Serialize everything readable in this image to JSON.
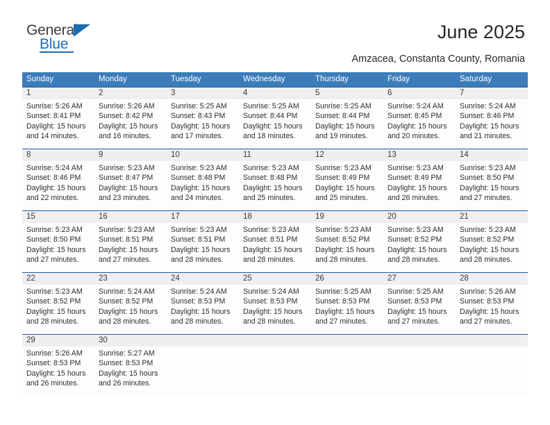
{
  "brand": {
    "name_part1": "General",
    "name_part2": "Blue",
    "triangle_icon": "triangle-icon",
    "accent_color": "#1f6cb0"
  },
  "header": {
    "title": "June 2025",
    "subtitle": "Amzacea, Constanta County, Romania"
  },
  "calendar": {
    "header_bg": "#3c7cba",
    "day_number_bg": "#efefef",
    "week_border_color": "#1f5d9b",
    "day_names": [
      "Sunday",
      "Monday",
      "Tuesday",
      "Wednesday",
      "Thursday",
      "Friday",
      "Saturday"
    ],
    "weeks": [
      [
        {
          "day": "1",
          "sunrise": "Sunrise: 5:26 AM",
          "sunset": "Sunset: 8:41 PM",
          "daylight_line1": "Daylight: 15 hours",
          "daylight_line2": "and 14 minutes."
        },
        {
          "day": "2",
          "sunrise": "Sunrise: 5:26 AM",
          "sunset": "Sunset: 8:42 PM",
          "daylight_line1": "Daylight: 15 hours",
          "daylight_line2": "and 16 minutes."
        },
        {
          "day": "3",
          "sunrise": "Sunrise: 5:25 AM",
          "sunset": "Sunset: 8:43 PM",
          "daylight_line1": "Daylight: 15 hours",
          "daylight_line2": "and 17 minutes."
        },
        {
          "day": "4",
          "sunrise": "Sunrise: 5:25 AM",
          "sunset": "Sunset: 8:44 PM",
          "daylight_line1": "Daylight: 15 hours",
          "daylight_line2": "and 18 minutes."
        },
        {
          "day": "5",
          "sunrise": "Sunrise: 5:25 AM",
          "sunset": "Sunset: 8:44 PM",
          "daylight_line1": "Daylight: 15 hours",
          "daylight_line2": "and 19 minutes."
        },
        {
          "day": "6",
          "sunrise": "Sunrise: 5:24 AM",
          "sunset": "Sunset: 8:45 PM",
          "daylight_line1": "Daylight: 15 hours",
          "daylight_line2": "and 20 minutes."
        },
        {
          "day": "7",
          "sunrise": "Sunrise: 5:24 AM",
          "sunset": "Sunset: 8:46 PM",
          "daylight_line1": "Daylight: 15 hours",
          "daylight_line2": "and 21 minutes."
        }
      ],
      [
        {
          "day": "8",
          "sunrise": "Sunrise: 5:24 AM",
          "sunset": "Sunset: 8:46 PM",
          "daylight_line1": "Daylight: 15 hours",
          "daylight_line2": "and 22 minutes."
        },
        {
          "day": "9",
          "sunrise": "Sunrise: 5:23 AM",
          "sunset": "Sunset: 8:47 PM",
          "daylight_line1": "Daylight: 15 hours",
          "daylight_line2": "and 23 minutes."
        },
        {
          "day": "10",
          "sunrise": "Sunrise: 5:23 AM",
          "sunset": "Sunset: 8:48 PM",
          "daylight_line1": "Daylight: 15 hours",
          "daylight_line2": "and 24 minutes."
        },
        {
          "day": "11",
          "sunrise": "Sunrise: 5:23 AM",
          "sunset": "Sunset: 8:48 PM",
          "daylight_line1": "Daylight: 15 hours",
          "daylight_line2": "and 25 minutes."
        },
        {
          "day": "12",
          "sunrise": "Sunrise: 5:23 AM",
          "sunset": "Sunset: 8:49 PM",
          "daylight_line1": "Daylight: 15 hours",
          "daylight_line2": "and 25 minutes."
        },
        {
          "day": "13",
          "sunrise": "Sunrise: 5:23 AM",
          "sunset": "Sunset: 8:49 PM",
          "daylight_line1": "Daylight: 15 hours",
          "daylight_line2": "and 26 minutes."
        },
        {
          "day": "14",
          "sunrise": "Sunrise: 5:23 AM",
          "sunset": "Sunset: 8:50 PM",
          "daylight_line1": "Daylight: 15 hours",
          "daylight_line2": "and 27 minutes."
        }
      ],
      [
        {
          "day": "15",
          "sunrise": "Sunrise: 5:23 AM",
          "sunset": "Sunset: 8:50 PM",
          "daylight_line1": "Daylight: 15 hours",
          "daylight_line2": "and 27 minutes."
        },
        {
          "day": "16",
          "sunrise": "Sunrise: 5:23 AM",
          "sunset": "Sunset: 8:51 PM",
          "daylight_line1": "Daylight: 15 hours",
          "daylight_line2": "and 27 minutes."
        },
        {
          "day": "17",
          "sunrise": "Sunrise: 5:23 AM",
          "sunset": "Sunset: 8:51 PM",
          "daylight_line1": "Daylight: 15 hours",
          "daylight_line2": "and 28 minutes."
        },
        {
          "day": "18",
          "sunrise": "Sunrise: 5:23 AM",
          "sunset": "Sunset: 8:51 PM",
          "daylight_line1": "Daylight: 15 hours",
          "daylight_line2": "and 28 minutes."
        },
        {
          "day": "19",
          "sunrise": "Sunrise: 5:23 AM",
          "sunset": "Sunset: 8:52 PM",
          "daylight_line1": "Daylight: 15 hours",
          "daylight_line2": "and 28 minutes."
        },
        {
          "day": "20",
          "sunrise": "Sunrise: 5:23 AM",
          "sunset": "Sunset: 8:52 PM",
          "daylight_line1": "Daylight: 15 hours",
          "daylight_line2": "and 28 minutes."
        },
        {
          "day": "21",
          "sunrise": "Sunrise: 5:23 AM",
          "sunset": "Sunset: 8:52 PM",
          "daylight_line1": "Daylight: 15 hours",
          "daylight_line2": "and 28 minutes."
        }
      ],
      [
        {
          "day": "22",
          "sunrise": "Sunrise: 5:23 AM",
          "sunset": "Sunset: 8:52 PM",
          "daylight_line1": "Daylight: 15 hours",
          "daylight_line2": "and 28 minutes."
        },
        {
          "day": "23",
          "sunrise": "Sunrise: 5:24 AM",
          "sunset": "Sunset: 8:52 PM",
          "daylight_line1": "Daylight: 15 hours",
          "daylight_line2": "and 28 minutes."
        },
        {
          "day": "24",
          "sunrise": "Sunrise: 5:24 AM",
          "sunset": "Sunset: 8:53 PM",
          "daylight_line1": "Daylight: 15 hours",
          "daylight_line2": "and 28 minutes."
        },
        {
          "day": "25",
          "sunrise": "Sunrise: 5:24 AM",
          "sunset": "Sunset: 8:53 PM",
          "daylight_line1": "Daylight: 15 hours",
          "daylight_line2": "and 28 minutes."
        },
        {
          "day": "26",
          "sunrise": "Sunrise: 5:25 AM",
          "sunset": "Sunset: 8:53 PM",
          "daylight_line1": "Daylight: 15 hours",
          "daylight_line2": "and 27 minutes."
        },
        {
          "day": "27",
          "sunrise": "Sunrise: 5:25 AM",
          "sunset": "Sunset: 8:53 PM",
          "daylight_line1": "Daylight: 15 hours",
          "daylight_line2": "and 27 minutes."
        },
        {
          "day": "28",
          "sunrise": "Sunrise: 5:26 AM",
          "sunset": "Sunset: 8:53 PM",
          "daylight_line1": "Daylight: 15 hours",
          "daylight_line2": "and 27 minutes."
        }
      ],
      [
        {
          "day": "29",
          "sunrise": "Sunrise: 5:26 AM",
          "sunset": "Sunset: 8:53 PM",
          "daylight_line1": "Daylight: 15 hours",
          "daylight_line2": "and 26 minutes."
        },
        {
          "day": "30",
          "sunrise": "Sunrise: 5:27 AM",
          "sunset": "Sunset: 8:53 PM",
          "daylight_line1": "Daylight: 15 hours",
          "daylight_line2": "and 26 minutes."
        },
        {
          "day": "",
          "sunrise": "",
          "sunset": "",
          "daylight_line1": "",
          "daylight_line2": ""
        },
        {
          "day": "",
          "sunrise": "",
          "sunset": "",
          "daylight_line1": "",
          "daylight_line2": ""
        },
        {
          "day": "",
          "sunrise": "",
          "sunset": "",
          "daylight_line1": "",
          "daylight_line2": ""
        },
        {
          "day": "",
          "sunrise": "",
          "sunset": "",
          "daylight_line1": "",
          "daylight_line2": ""
        },
        {
          "day": "",
          "sunrise": "",
          "sunset": "",
          "daylight_line1": "",
          "daylight_line2": ""
        }
      ]
    ]
  }
}
